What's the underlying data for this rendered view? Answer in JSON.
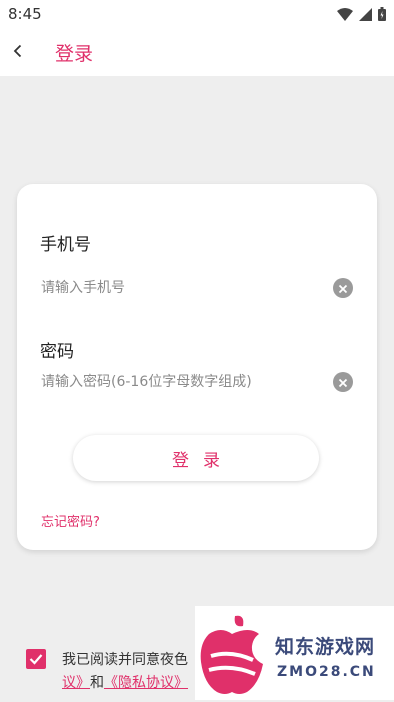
{
  "status_bar": {
    "time": "8:45",
    "icons": [
      "wifi-icon",
      "signal-icon",
      "battery-icon"
    ]
  },
  "app_bar": {
    "title": "登录",
    "back_icon": "chevron-left-icon"
  },
  "form": {
    "phone_label": "手机号",
    "phone_value": "",
    "phone_placeholder": "请输入手机号",
    "password_label": "密码",
    "password_value": "",
    "password_placeholder": "请输入密码(6-16位字母数字组成)",
    "clear_icon": "clear-circle-icon",
    "login_button": "登录",
    "forgot_password": "忘记密码?"
  },
  "agreement": {
    "checked": true,
    "line1_text": "我已阅读并同意夜色",
    "line2_link1": "议》",
    "line2_and": "和",
    "line2_link2": "《隐私协议》"
  },
  "watermark": {
    "logo": "apple-logo",
    "text1": "知东游戏网",
    "text2": "ZMO28.CN"
  },
  "colors": {
    "accent": "#e0306a",
    "background": "#eeeeee",
    "card": "#ffffff",
    "watermark_text": "#3b4a7a"
  }
}
